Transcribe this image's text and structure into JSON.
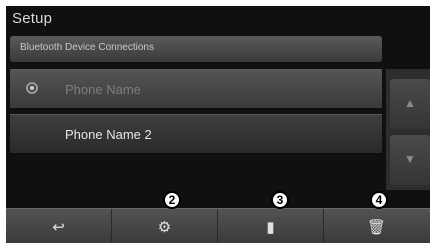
{
  "window": {
    "title": "Setup"
  },
  "subheader": {
    "label": "Bluetooth Device Connections"
  },
  "device_list": {
    "items": [
      {
        "label": "Phone Name",
        "selected": true
      },
      {
        "label": "Phone Name 2",
        "selected": false
      }
    ]
  },
  "scrollbar": {
    "up_icon": "chevron-up-icon",
    "down_icon": "chevron-down-icon"
  },
  "bottom_bar": {
    "buttons": [
      {
        "name": "back",
        "icon": "back-arrow-icon",
        "glyph": "↩"
      },
      {
        "name": "settings",
        "icon": "gear-icon",
        "glyph": "⚙"
      },
      {
        "name": "info",
        "icon": "document-icon",
        "glyph": "▮"
      },
      {
        "name": "delete",
        "icon": "trash-icon",
        "glyph": "🗑"
      }
    ]
  },
  "callouts": [
    "2",
    "3",
    "4"
  ]
}
